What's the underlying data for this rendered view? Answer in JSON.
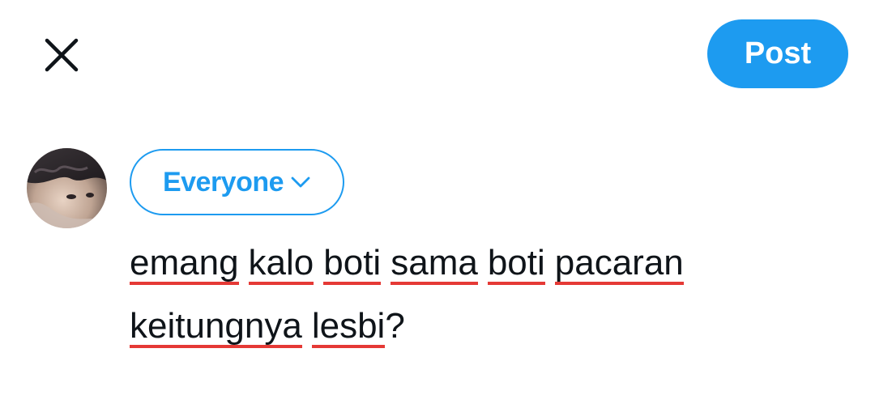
{
  "header": {
    "close_icon": "close-icon",
    "post_label": "Post",
    "accent_color": "#1d9bf0"
  },
  "composer": {
    "avatar_icon": "user-avatar",
    "audience_label": "Everyone",
    "audience_icon": "chevron-down-icon",
    "text_line_1": [
      "emang",
      "kalo",
      "boti",
      "sama",
      "boti",
      "pacaran"
    ],
    "text_line_2": [
      "keitungnya",
      "lesbi",
      "?"
    ],
    "spellcheck_color": "#e53935"
  }
}
